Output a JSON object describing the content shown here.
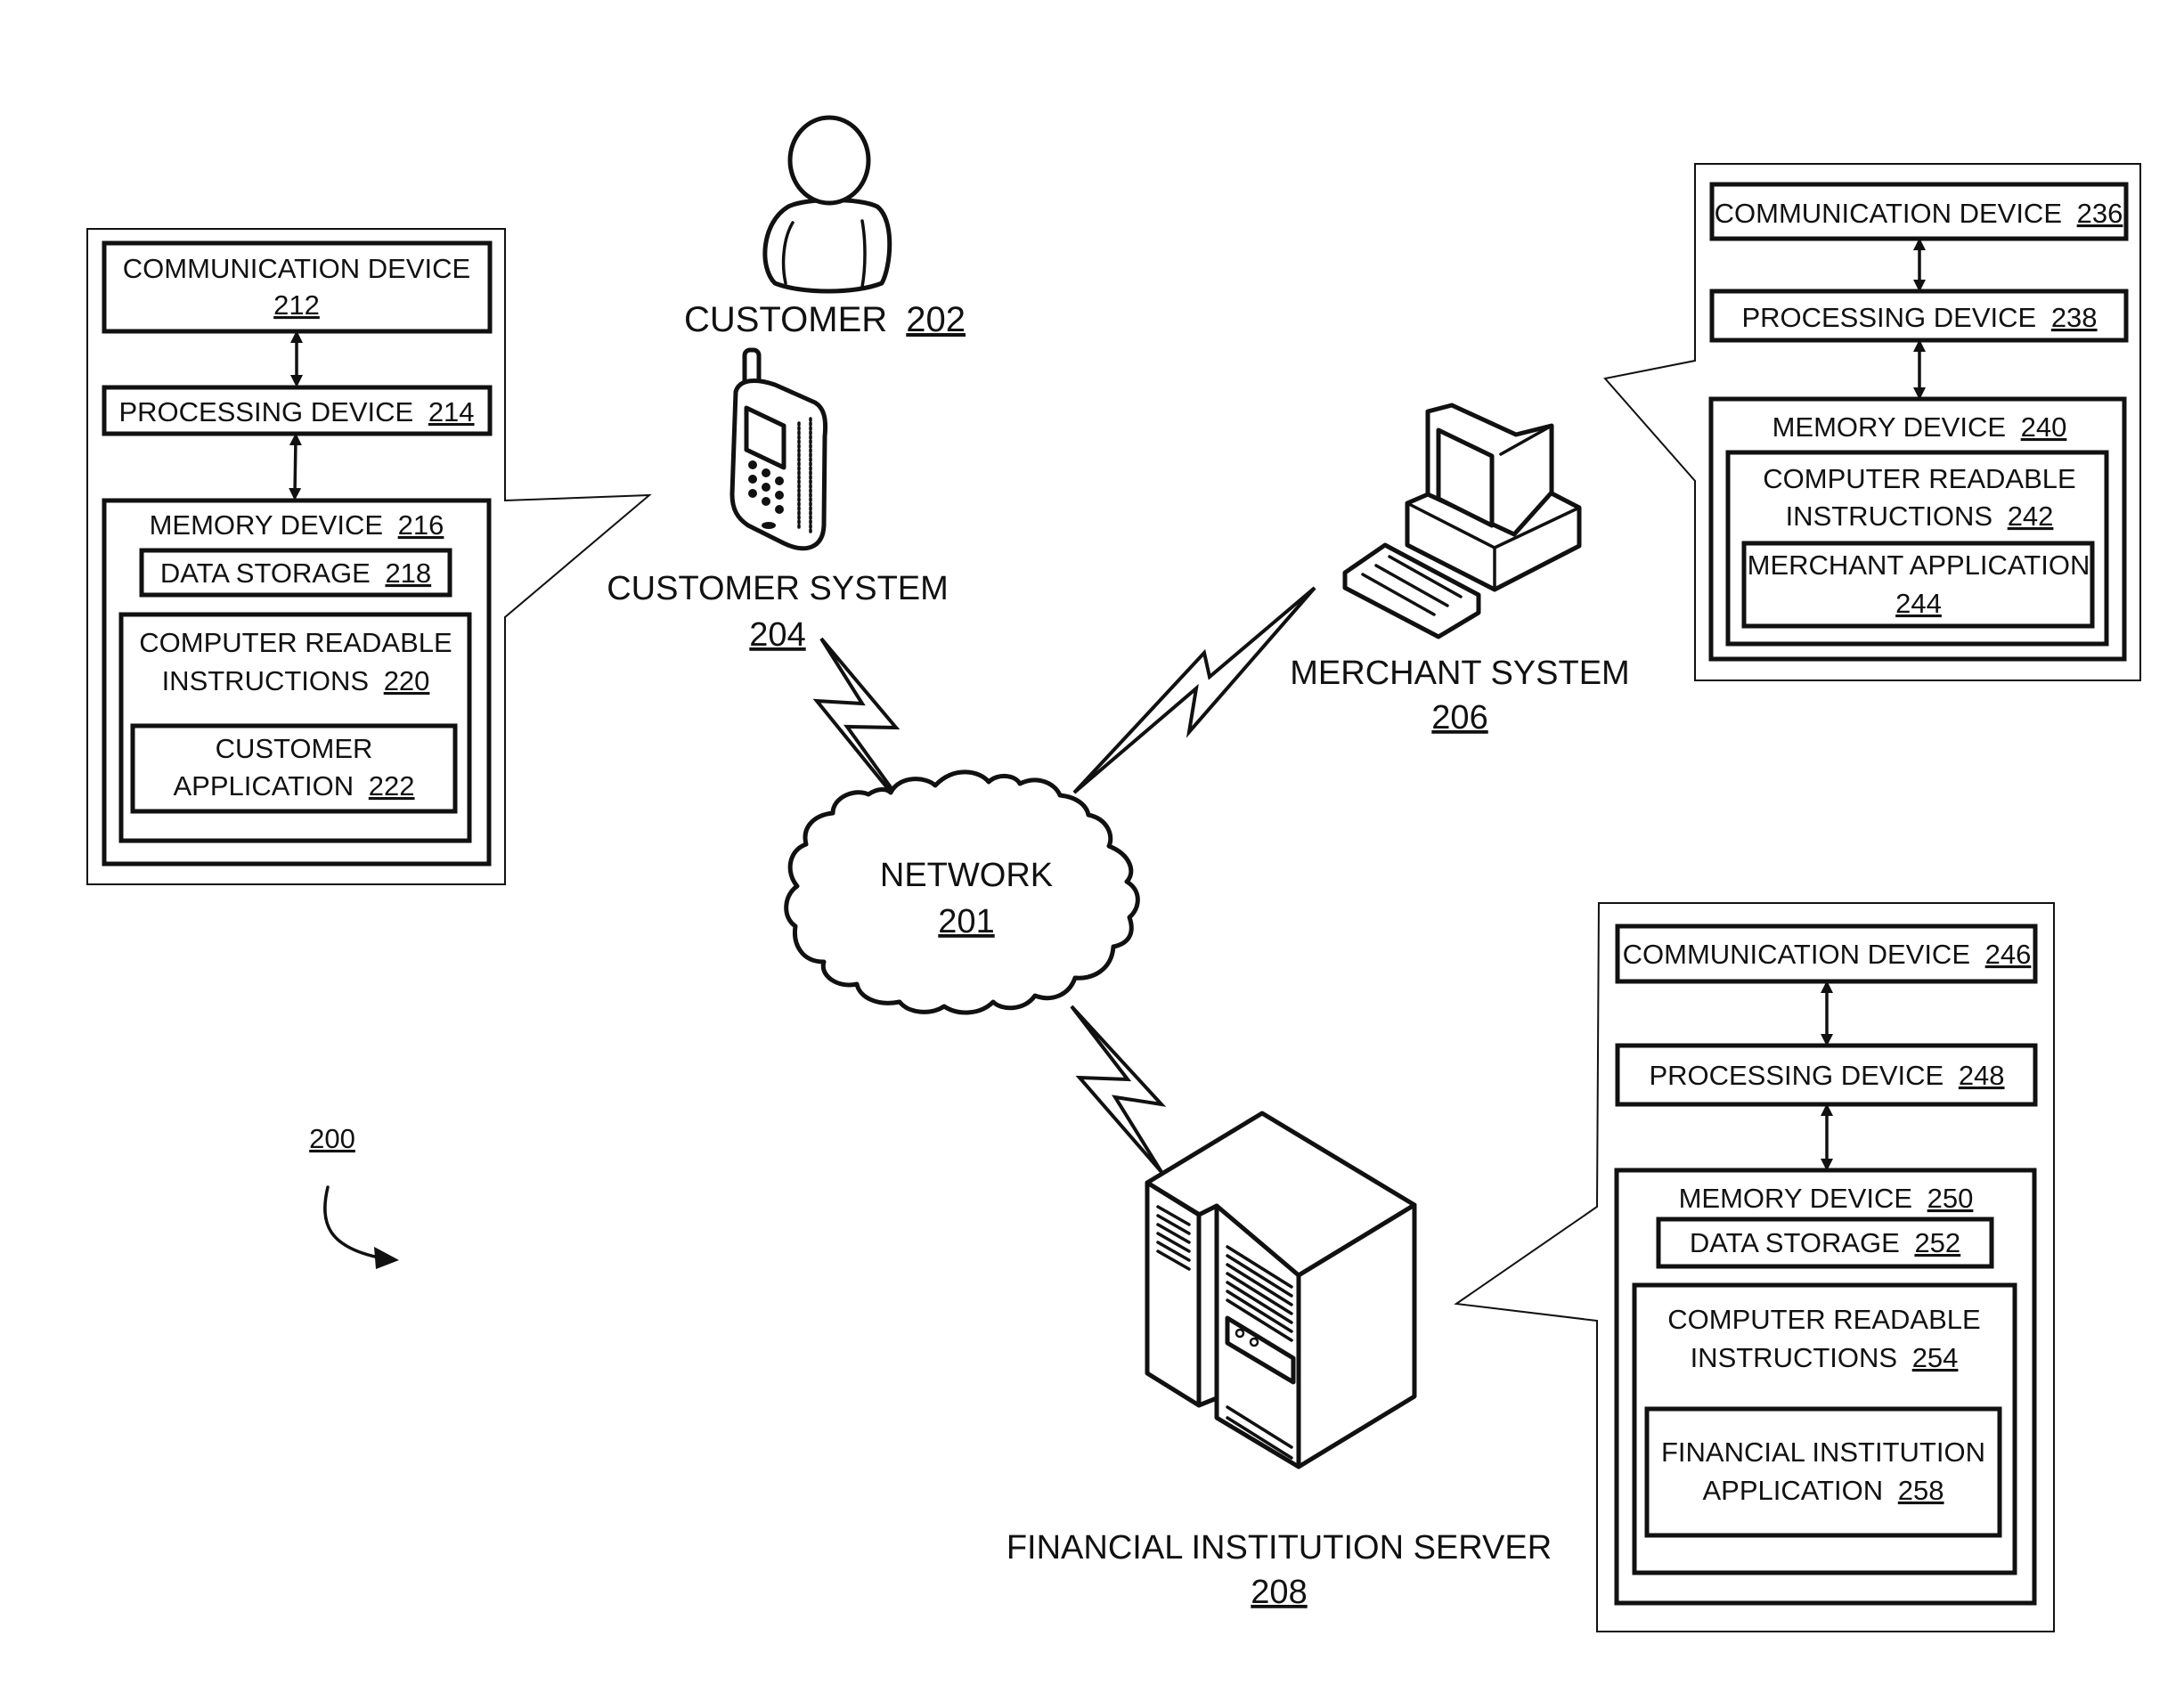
{
  "figure": {
    "reference_number": "200"
  },
  "customer": {
    "label": "CUSTOMER",
    "ref": "202",
    "icon": "person-icon"
  },
  "customer_system": {
    "label": "CUSTOMER SYSTEM",
    "ref": "204",
    "icon": "mobile-phone-icon",
    "panel": {
      "communication_device": {
        "label": "COMMUNICATION DEVICE",
        "ref": "212"
      },
      "processing_device": {
        "label": "PROCESSING DEVICE",
        "ref": "214"
      },
      "memory_device": {
        "label": "MEMORY DEVICE",
        "ref": "216"
      },
      "data_storage": {
        "label": "DATA STORAGE",
        "ref": "218"
      },
      "computer_readable_instructions": {
        "line1": "COMPUTER READABLE",
        "line2": "INSTRUCTIONS",
        "ref": "220"
      },
      "application": {
        "line1": "CUSTOMER",
        "line2": "APPLICATION",
        "ref": "222"
      }
    }
  },
  "network": {
    "label": "NETWORK",
    "ref": "201",
    "icon": "cloud-icon"
  },
  "merchant_system": {
    "label": "MERCHANT SYSTEM",
    "ref": "206",
    "icon": "desktop-computer-icon",
    "panel": {
      "communication_device": {
        "label": "COMMUNICATION DEVICE",
        "ref": "236"
      },
      "processing_device": {
        "label": "PROCESSING DEVICE",
        "ref": "238"
      },
      "memory_device": {
        "label": "MEMORY DEVICE",
        "ref": "240"
      },
      "computer_readable_instructions": {
        "line1": "COMPUTER READABLE",
        "line2": "INSTRUCTIONS",
        "ref": "242"
      },
      "application": {
        "line1": "MERCHANT APPLICATION",
        "ref": "244"
      }
    }
  },
  "financial_institution_server": {
    "label": "FINANCIAL INSTITUTION SERVER",
    "ref": "208",
    "icon": "server-icon",
    "panel": {
      "communication_device": {
        "label": "COMMUNICATION DEVICE",
        "ref": "246"
      },
      "processing_device": {
        "label": "PROCESSING DEVICE",
        "ref": "248"
      },
      "memory_device": {
        "label": "MEMORY DEVICE",
        "ref": "250"
      },
      "data_storage": {
        "label": "DATA STORAGE",
        "ref": "252"
      },
      "computer_readable_instructions": {
        "line1": "COMPUTER READABLE",
        "line2": "INSTRUCTIONS",
        "ref": "254"
      },
      "application": {
        "line1": "FINANCIAL INSTITUTION",
        "line2": "APPLICATION",
        "ref": "258"
      }
    }
  }
}
